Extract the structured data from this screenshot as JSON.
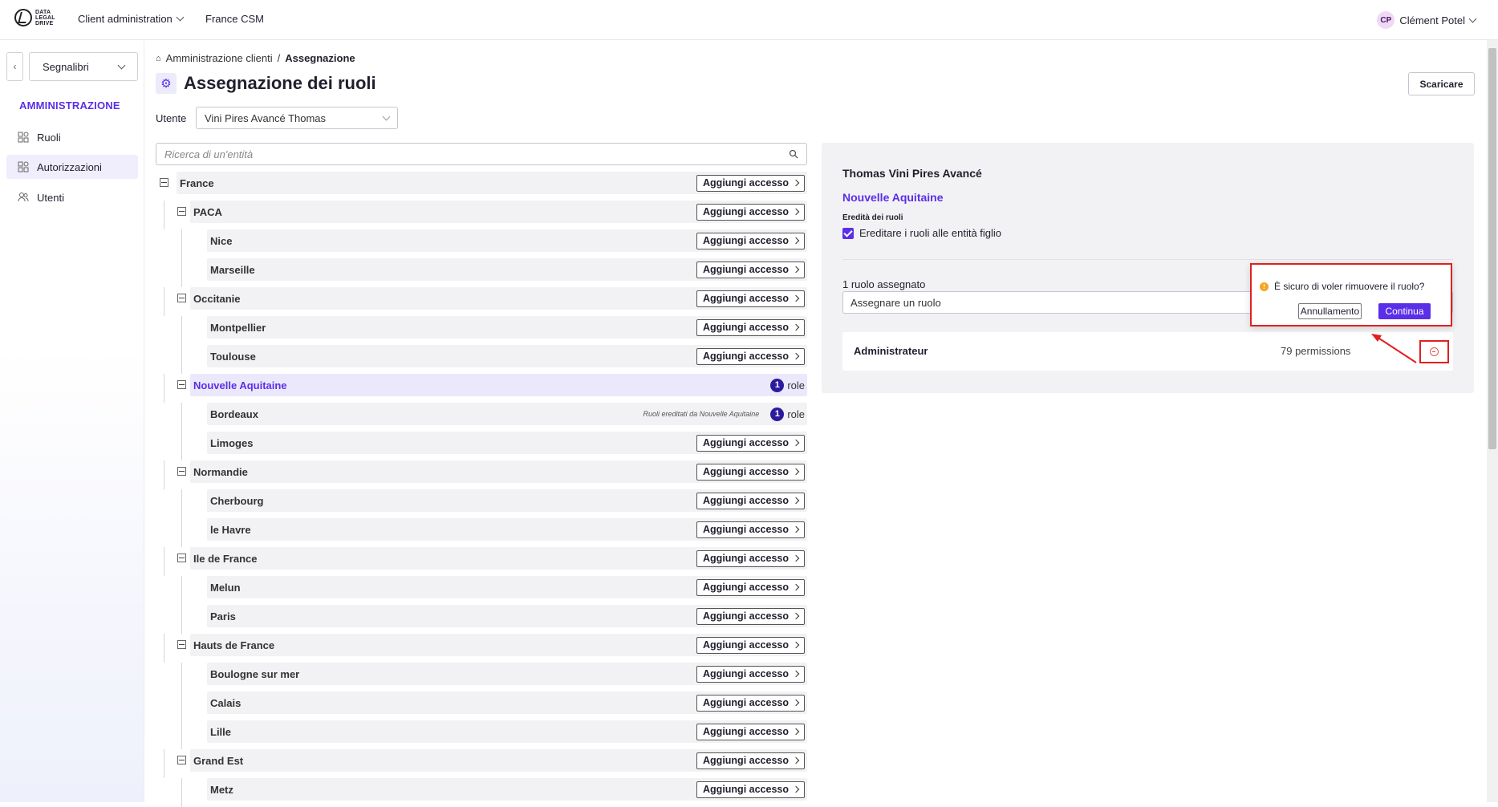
{
  "header": {
    "logo_text": [
      "DATA",
      "LEGAL",
      "DRIVE"
    ],
    "nav": [
      "Client administration",
      "France CSM"
    ],
    "user_initials": "CP",
    "user_name": "Clément Potel"
  },
  "sidebar": {
    "bookmarks_label": "Segnalibri",
    "section_title": "AMMINISTRAZIONE",
    "items": [
      {
        "label": "Ruoli",
        "icon": "grid-icon"
      },
      {
        "label": "Autorizzazioni",
        "icon": "grid-icon"
      },
      {
        "label": "Utenti",
        "icon": "users-icon"
      }
    ],
    "active_item": "Autorizzazioni"
  },
  "main": {
    "breadcrumb": {
      "parent": "Amministrazione clienti",
      "separator": "/",
      "current": "Assegnazione"
    },
    "title": "Assegnazione dei ruoli",
    "download_label": "Scaricare",
    "user_label": "Utente",
    "user_value": "Vini Pires Avancé Thomas",
    "search_placeholder": "Ricerca di un'entità",
    "add_access_label": "Aggiungi accesso",
    "role_word": "role",
    "tree": [
      {
        "name": "France",
        "level": 0,
        "type": "group"
      },
      {
        "name": "PACA",
        "level": 1,
        "type": "group"
      },
      {
        "name": "Nice",
        "level": 2,
        "type": "leaf"
      },
      {
        "name": "Marseille",
        "level": 2,
        "type": "leaf"
      },
      {
        "name": "Occitanie",
        "level": 1,
        "type": "group"
      },
      {
        "name": "Montpellier",
        "level": 2,
        "type": "leaf"
      },
      {
        "name": "Toulouse",
        "level": 2,
        "type": "leaf"
      },
      {
        "name": "Nouvelle Aquitaine",
        "level": 1,
        "type": "group",
        "selected": true,
        "roles": "1"
      },
      {
        "name": "Bordeaux",
        "level": 2,
        "type": "leaf",
        "roles": "1",
        "inherited": "Ruoli ereditati da Nouvelle Aquitaine"
      },
      {
        "name": "Limoges",
        "level": 2,
        "type": "leaf"
      },
      {
        "name": "Normandie",
        "level": 1,
        "type": "group"
      },
      {
        "name": "Cherbourg",
        "level": 2,
        "type": "leaf"
      },
      {
        "name": "le Havre",
        "level": 2,
        "type": "leaf"
      },
      {
        "name": "Ile de France",
        "level": 1,
        "type": "group"
      },
      {
        "name": "Melun",
        "level": 2,
        "type": "leaf"
      },
      {
        "name": "Paris",
        "level": 2,
        "type": "leaf"
      },
      {
        "name": "Hauts de France",
        "level": 1,
        "type": "group"
      },
      {
        "name": "Boulogne sur mer",
        "level": 2,
        "type": "leaf"
      },
      {
        "name": "Calais",
        "level": 2,
        "type": "leaf"
      },
      {
        "name": "Lille",
        "level": 2,
        "type": "leaf"
      },
      {
        "name": "Grand Est",
        "level": 1,
        "type": "group"
      },
      {
        "name": "Metz",
        "level": 2,
        "type": "leaf"
      }
    ]
  },
  "panel": {
    "user_name": "Thomas Vini Pires Avancé",
    "entity": "Nouvelle Aquitaine",
    "inherit_label": "Eredità dei ruoli",
    "inherit_checkbox": "Ereditare i ruoli alle entità figlio",
    "inherit_checked": true,
    "assigned_count": "1 ruolo assegnato",
    "assign_placeholder": "Assegnare un ruolo",
    "role": {
      "name": "Administrateur",
      "permissions": "79 permissions"
    }
  },
  "popconfirm": {
    "message": "È sicuro di voler rimuovere il ruolo?",
    "cancel": "Annullamento",
    "confirm": "Continua"
  },
  "colors": {
    "accent": "#5b2ee8",
    "highlight": "#e02020",
    "badge": "#2b1a9e"
  }
}
